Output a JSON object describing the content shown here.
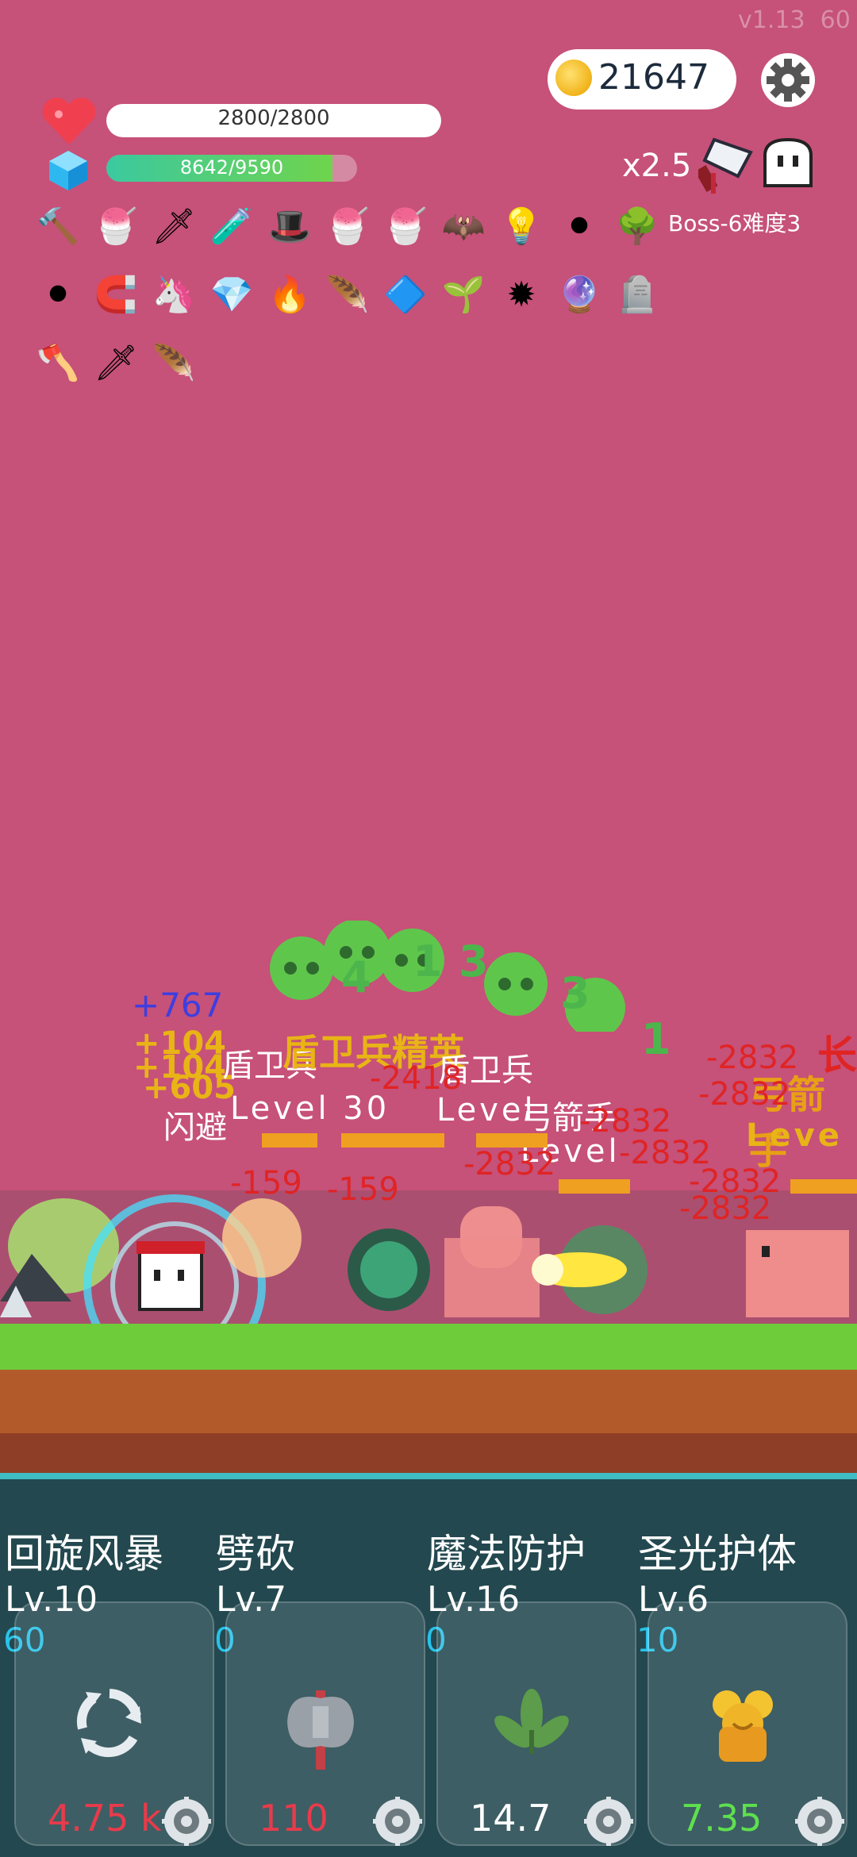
{
  "version": "v1.13",
  "fps": "60",
  "coins": "21647",
  "hp_text": "2800/2800",
  "mp_text": "8642/9590",
  "mp_fraction": 0.901,
  "speed": "x2.5",
  "boss_label": "Boss-6难度3",
  "items": [
    "hammer-icon",
    "ice-cream-icon",
    "sword-icon",
    "potion-icon",
    "wizard-hat-icon",
    "ice-cream-icon",
    "ice-cream-icon",
    "bat-icon",
    "lightbulb-icon",
    "cauldron-icon",
    "tree-icon",
    "cauldron-icon",
    "magnet-icon",
    "unicorn-icon",
    "diamond-icon",
    "flame-icon",
    "wing-icon",
    "crystal-icon",
    "plant-icon",
    "spiked-ball-icon",
    "crystal-ball-icon",
    "gravestone-icon",
    "axe-icon",
    "dagger-icon",
    "wing-icon"
  ],
  "battle": {
    "skull_counts": [
      "4",
      "1",
      "3",
      "3",
      "1"
    ],
    "heal_767": "+767",
    "heal_104a": "+104",
    "heal_104b": "+104",
    "heal_605": "+605",
    "dodge": "闪避",
    "enemy_name_1": "盾卫兵",
    "enemy_title": "盾卫兵精英",
    "enemy_name_2": "盾卫兵",
    "archer": "弓箭手",
    "archer2": "弓箭手",
    "long": "长",
    "level_30": "Level 30",
    "level": "Level",
    "level2": "Leve",
    "dmg_2832": "-2832",
    "dmg_159": "-159",
    "dmg_2418": "-2418"
  },
  "skills": [
    {
      "name": "回旋风暴",
      "level": "Lv.10",
      "count": "60",
      "cost": "4.75 k",
      "cost_color": "#e83b4b",
      "icon": "cycle-icon"
    },
    {
      "name": "劈砍",
      "level": "Lv.7",
      "count": "0",
      "cost": "110",
      "cost_color": "#e83b4b",
      "icon": "axe-icon"
    },
    {
      "name": "魔法防护",
      "level": "Lv.16",
      "count": "0",
      "cost": "14.7",
      "cost_color": "#ffffff",
      "icon": "leaf-icon"
    },
    {
      "name": "圣光护体",
      "level": "Lv.6",
      "count": "10",
      "cost": "7.35",
      "cost_color": "#5ee04e",
      "icon": "halo-icon"
    }
  ]
}
